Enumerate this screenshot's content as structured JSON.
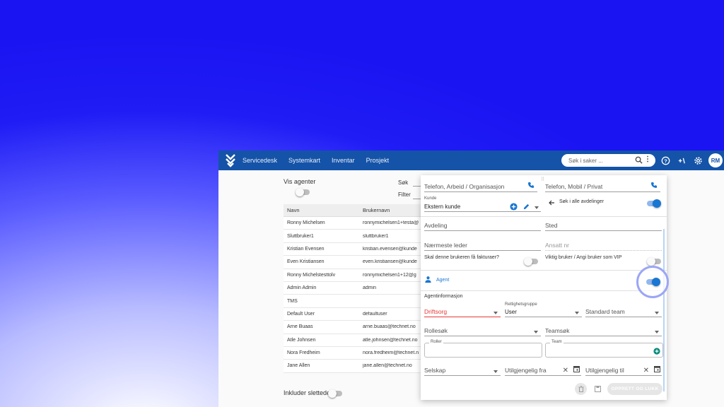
{
  "nav": {
    "items": [
      "Servicedesk",
      "Systemkart",
      "Inventar",
      "Prosjekt"
    ],
    "search_placeholder": "Søk i saker ...",
    "avatar_initials": "RM"
  },
  "list": {
    "show_agents_label": "Vis agenter",
    "search_label": "Søk",
    "filter_label": "Filter",
    "columns": [
      "Navn",
      "Brukernavn"
    ],
    "rows": [
      [
        "Ronny Michelsen",
        "ronnymichelsen1+testa@"
      ],
      [
        "Sluttbruker1",
        "sluttbruker1"
      ],
      [
        "Kristian Evensen",
        "kristian.evensen@kunde"
      ],
      [
        "Even Kristiansen",
        "even.kristiansen@kunde"
      ],
      [
        "Ronny Michelstesttolv",
        "ronnymichelsen1+12@g"
      ],
      [
        "Admin Admin",
        "admin"
      ],
      [
        "TMS",
        ""
      ],
      [
        "Default User",
        "defaultuser"
      ],
      [
        "Arne Buaas",
        "arne.buaas@technet.no"
      ],
      [
        "Atle Johnsen",
        "atle.johnsen@technet.no"
      ],
      [
        "Nora Fredheim",
        "nora.fredheim@technet.n"
      ],
      [
        "Jane Allen",
        "jane.allen@technet.no"
      ]
    ],
    "include_deleted_label": "Inkluder slettede"
  },
  "form": {
    "phone_work_placeholder": "Telefon, Arbeid / Organisasjon",
    "phone_mobile_placeholder": "Telefon, Mobil / Privat",
    "customer_label": "Kunde",
    "customer_value": "Ekstern kunde",
    "search_all_departments_label": "Søk i alle avdelinger",
    "department_placeholder": "Avdeling",
    "location_placeholder": "Sted",
    "manager_placeholder": "Nærmeste leder",
    "employee_no_placeholder": "Ansatt nr",
    "invoice_question": "Skal denne brukeren få fakturaer?",
    "vip_label": "Viktig bruker / Angi bruker som VIP",
    "agent_label": "Agent",
    "agent_info_heading": "Agentinformasjon",
    "org_placeholder": "Driftsorg",
    "rights_group_label": "Rettighetsgruppe",
    "rights_group_value": "User",
    "standard_team_placeholder": "Standard team",
    "role_search_placeholder": "Rollesøk",
    "team_search_placeholder": "Teamsøk",
    "roles_legend": "Roller",
    "team_legend": "Team",
    "company_placeholder": "Selskap",
    "unavailable_from_placeholder": "Utilgjengelig fra",
    "unavailable_to_placeholder": "Utilgjengelig til",
    "create_close_button": "OPPRETT OG LUKK"
  },
  "colors": {
    "navbar": "#1553a8",
    "accent": "#1976d2",
    "error": "#e53935",
    "teal": "#00897b"
  }
}
